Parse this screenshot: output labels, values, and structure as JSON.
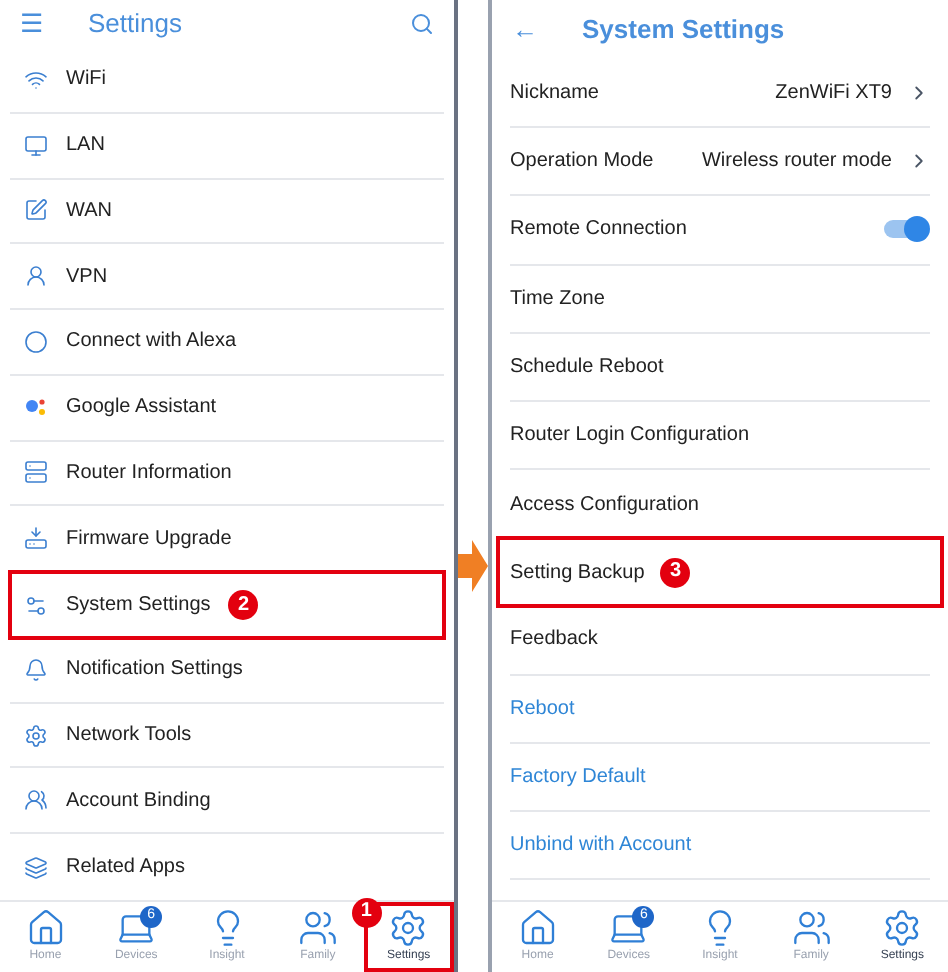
{
  "left_screen": {
    "header": {
      "menu": "☰",
      "title": "Settings"
    },
    "rows": [
      {
        "label": "WiFi",
        "highlighted": false
      },
      {
        "label": "LAN",
        "highlighted": false
      },
      {
        "label": "WAN",
        "highlighted": false
      },
      {
        "label": "VPN",
        "highlighted": false
      },
      {
        "label": "Connect with Alexa",
        "highlighted": false
      },
      {
        "label": "Google Assistant",
        "highlighted": false
      },
      {
        "label": "Router Information",
        "highlighted": false
      },
      {
        "label": "Firmware Upgrade",
        "highlighted": false
      },
      {
        "label": "System Settings",
        "highlighted": true,
        "step": "2"
      },
      {
        "label": "Notification Settings",
        "highlighted": false
      },
      {
        "label": "Network Tools",
        "highlighted": false
      },
      {
        "label": "Account Binding",
        "highlighted": false
      },
      {
        "label": "Related Apps",
        "highlighted": false
      }
    ],
    "nav": [
      {
        "label": "Home",
        "selected": false,
        "highlighted": false
      },
      {
        "label": "Devices",
        "selected": false,
        "badge": "6",
        "highlighted": false
      },
      {
        "label": "Insight",
        "selected": false,
        "highlighted": false
      },
      {
        "label": "Family",
        "selected": false,
        "highlighted": false
      },
      {
        "label": "Settings",
        "selected": true,
        "highlighted": true,
        "step": "1"
      }
    ]
  },
  "right_screen": {
    "header": {
      "back": "←",
      "title": "System Settings"
    },
    "rows": [
      {
        "kind": "value",
        "label": "Nickname",
        "value": "ZenWiFi XT9",
        "highlighted": false
      },
      {
        "kind": "value",
        "label": "Operation Mode",
        "value": "Wireless router mode",
        "highlighted": false
      },
      {
        "kind": "toggle",
        "label": "Remote Connection",
        "on": true,
        "highlighted": false
      },
      {
        "kind": "plain",
        "label": "Time Zone",
        "highlighted": false
      },
      {
        "kind": "plain",
        "label": "Schedule Reboot",
        "highlighted": false
      },
      {
        "kind": "plain",
        "label": "Router Login Configuration",
        "highlighted": false
      },
      {
        "kind": "plain",
        "label": "Access Configuration",
        "highlighted": false
      },
      {
        "kind": "plain",
        "label": "Setting Backup",
        "highlighted": true,
        "step": "3"
      },
      {
        "kind": "plain",
        "label": "Feedback",
        "highlighted": false
      },
      {
        "kind": "action",
        "label": "Reboot",
        "highlighted": false
      },
      {
        "kind": "action",
        "label": "Factory Default",
        "highlighted": false
      },
      {
        "kind": "action",
        "label": "Unbind with Account",
        "highlighted": false
      }
    ],
    "nav": [
      {
        "label": "Home",
        "selected": false,
        "highlighted": false
      },
      {
        "label": "Devices",
        "selected": false,
        "badge": "6",
        "highlighted": false
      },
      {
        "label": "Insight",
        "selected": false,
        "highlighted": false
      },
      {
        "label": "Family",
        "selected": false,
        "highlighted": false
      },
      {
        "label": "Settings",
        "selected": true,
        "highlighted": false
      }
    ]
  }
}
